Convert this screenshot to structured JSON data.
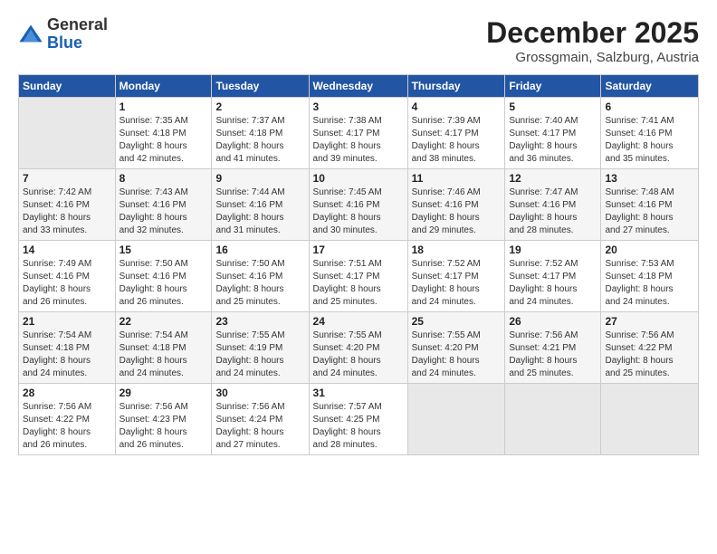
{
  "header": {
    "logo_general": "General",
    "logo_blue": "Blue",
    "title": "December 2025",
    "subtitle": "Grossgmain, Salzburg, Austria"
  },
  "weekdays": [
    "Sunday",
    "Monday",
    "Tuesday",
    "Wednesday",
    "Thursday",
    "Friday",
    "Saturday"
  ],
  "weeks": [
    [
      {
        "day": "",
        "info": ""
      },
      {
        "day": "1",
        "info": "Sunrise: 7:35 AM\nSunset: 4:18 PM\nDaylight: 8 hours\nand 42 minutes."
      },
      {
        "day": "2",
        "info": "Sunrise: 7:37 AM\nSunset: 4:18 PM\nDaylight: 8 hours\nand 41 minutes."
      },
      {
        "day": "3",
        "info": "Sunrise: 7:38 AM\nSunset: 4:17 PM\nDaylight: 8 hours\nand 39 minutes."
      },
      {
        "day": "4",
        "info": "Sunrise: 7:39 AM\nSunset: 4:17 PM\nDaylight: 8 hours\nand 38 minutes."
      },
      {
        "day": "5",
        "info": "Sunrise: 7:40 AM\nSunset: 4:17 PM\nDaylight: 8 hours\nand 36 minutes."
      },
      {
        "day": "6",
        "info": "Sunrise: 7:41 AM\nSunset: 4:16 PM\nDaylight: 8 hours\nand 35 minutes."
      }
    ],
    [
      {
        "day": "7",
        "info": "Sunrise: 7:42 AM\nSunset: 4:16 PM\nDaylight: 8 hours\nand 33 minutes."
      },
      {
        "day": "8",
        "info": "Sunrise: 7:43 AM\nSunset: 4:16 PM\nDaylight: 8 hours\nand 32 minutes."
      },
      {
        "day": "9",
        "info": "Sunrise: 7:44 AM\nSunset: 4:16 PM\nDaylight: 8 hours\nand 31 minutes."
      },
      {
        "day": "10",
        "info": "Sunrise: 7:45 AM\nSunset: 4:16 PM\nDaylight: 8 hours\nand 30 minutes."
      },
      {
        "day": "11",
        "info": "Sunrise: 7:46 AM\nSunset: 4:16 PM\nDaylight: 8 hours\nand 29 minutes."
      },
      {
        "day": "12",
        "info": "Sunrise: 7:47 AM\nSunset: 4:16 PM\nDaylight: 8 hours\nand 28 minutes."
      },
      {
        "day": "13",
        "info": "Sunrise: 7:48 AM\nSunset: 4:16 PM\nDaylight: 8 hours\nand 27 minutes."
      }
    ],
    [
      {
        "day": "14",
        "info": "Sunrise: 7:49 AM\nSunset: 4:16 PM\nDaylight: 8 hours\nand 26 minutes."
      },
      {
        "day": "15",
        "info": "Sunrise: 7:50 AM\nSunset: 4:16 PM\nDaylight: 8 hours\nand 26 minutes."
      },
      {
        "day": "16",
        "info": "Sunrise: 7:50 AM\nSunset: 4:16 PM\nDaylight: 8 hours\nand 25 minutes."
      },
      {
        "day": "17",
        "info": "Sunrise: 7:51 AM\nSunset: 4:17 PM\nDaylight: 8 hours\nand 25 minutes."
      },
      {
        "day": "18",
        "info": "Sunrise: 7:52 AM\nSunset: 4:17 PM\nDaylight: 8 hours\nand 24 minutes."
      },
      {
        "day": "19",
        "info": "Sunrise: 7:52 AM\nSunset: 4:17 PM\nDaylight: 8 hours\nand 24 minutes."
      },
      {
        "day": "20",
        "info": "Sunrise: 7:53 AM\nSunset: 4:18 PM\nDaylight: 8 hours\nand 24 minutes."
      }
    ],
    [
      {
        "day": "21",
        "info": "Sunrise: 7:54 AM\nSunset: 4:18 PM\nDaylight: 8 hours\nand 24 minutes."
      },
      {
        "day": "22",
        "info": "Sunrise: 7:54 AM\nSunset: 4:18 PM\nDaylight: 8 hours\nand 24 minutes."
      },
      {
        "day": "23",
        "info": "Sunrise: 7:55 AM\nSunset: 4:19 PM\nDaylight: 8 hours\nand 24 minutes."
      },
      {
        "day": "24",
        "info": "Sunrise: 7:55 AM\nSunset: 4:20 PM\nDaylight: 8 hours\nand 24 minutes."
      },
      {
        "day": "25",
        "info": "Sunrise: 7:55 AM\nSunset: 4:20 PM\nDaylight: 8 hours\nand 24 minutes."
      },
      {
        "day": "26",
        "info": "Sunrise: 7:56 AM\nSunset: 4:21 PM\nDaylight: 8 hours\nand 25 minutes."
      },
      {
        "day": "27",
        "info": "Sunrise: 7:56 AM\nSunset: 4:22 PM\nDaylight: 8 hours\nand 25 minutes."
      }
    ],
    [
      {
        "day": "28",
        "info": "Sunrise: 7:56 AM\nSunset: 4:22 PM\nDaylight: 8 hours\nand 26 minutes."
      },
      {
        "day": "29",
        "info": "Sunrise: 7:56 AM\nSunset: 4:23 PM\nDaylight: 8 hours\nand 26 minutes."
      },
      {
        "day": "30",
        "info": "Sunrise: 7:56 AM\nSunset: 4:24 PM\nDaylight: 8 hours\nand 27 minutes."
      },
      {
        "day": "31",
        "info": "Sunrise: 7:57 AM\nSunset: 4:25 PM\nDaylight: 8 hours\nand 28 minutes."
      },
      {
        "day": "",
        "info": ""
      },
      {
        "day": "",
        "info": ""
      },
      {
        "day": "",
        "info": ""
      }
    ]
  ]
}
